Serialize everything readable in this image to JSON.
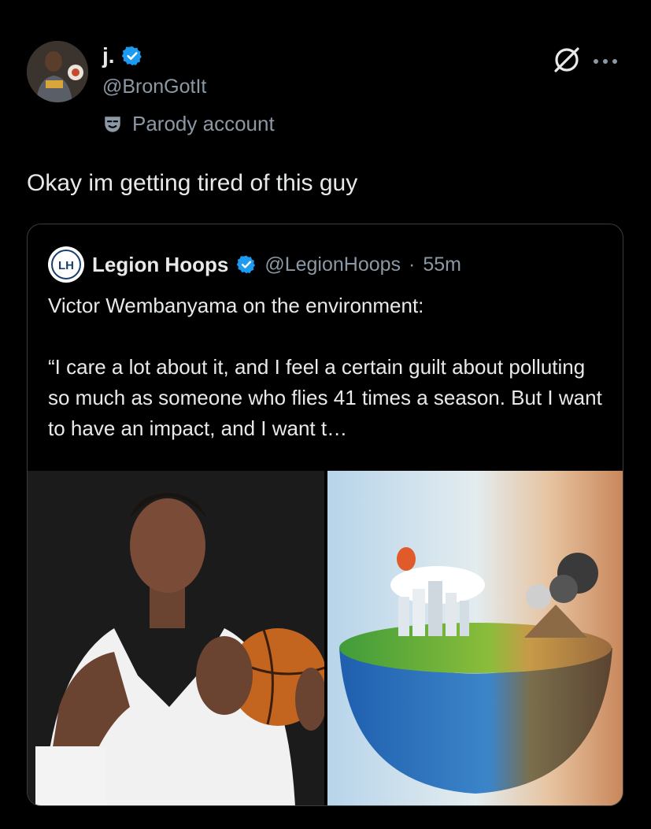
{
  "author": {
    "name": "j.",
    "handle": "@BronGotIt",
    "label": "Parody account",
    "verified": true
  },
  "tweet": {
    "text": "Okay im getting tired of this guy"
  },
  "quoted": {
    "name": "Legion Hoops",
    "handle": "@LegionHoops",
    "separator": "·",
    "time": "55m",
    "text": "Victor Wembanyama on the environment:\n\n“I care a lot about it, and I feel a certain guilt about polluting so much as someone who flies 41 times a season. But I want to have an impact, and I want t…",
    "logo_text": "LH",
    "media": [
      {
        "description_icon": "basketball-player-photo"
      },
      {
        "description_icon": "earth-environment-illustration"
      }
    ]
  },
  "colors": {
    "background": "#000000",
    "text": "#e7e9ea",
    "secondary": "#8b98a5",
    "verified_blue": "#1d9bf0",
    "border": "#3a3d41"
  },
  "icons": {
    "grok": "grok-icon",
    "more": "more-icon",
    "parody": "mask-icon",
    "verified": "verified-badge-icon"
  }
}
